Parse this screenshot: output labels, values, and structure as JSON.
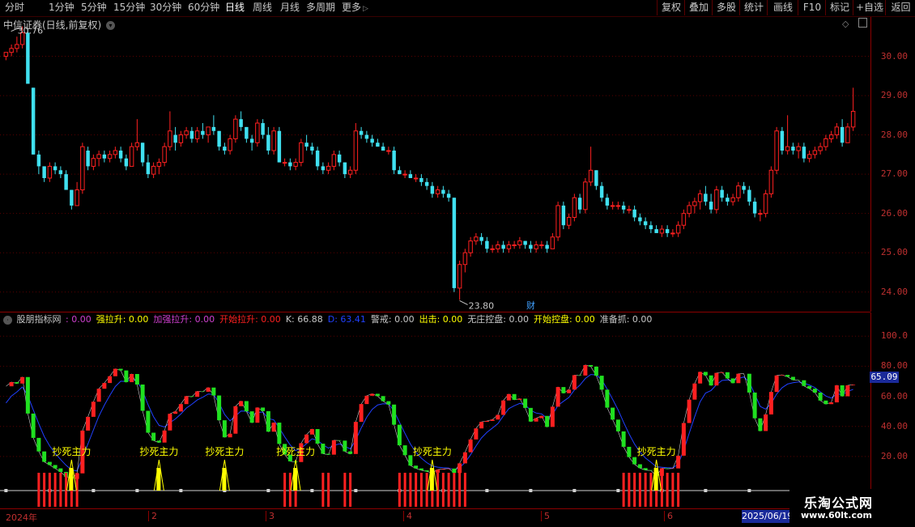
{
  "toolbar": {
    "periods": [
      "分时",
      "1分钟",
      "5分钟",
      "15分钟",
      "30分钟",
      "60分钟",
      "日线",
      "周线",
      "月线",
      "多周期",
      "更多"
    ],
    "active_period": "日线",
    "buttons": [
      "复权",
      "叠加",
      "多股",
      "统计",
      "画线",
      "F10",
      "标记",
      "+自选",
      "返回"
    ]
  },
  "main_chart": {
    "title": "中信证券(日线,前复权)",
    "high_label": "30.76",
    "low_label": "23.80",
    "marker_label": "财",
    "y_ticks": [
      "30.00",
      "29.00",
      "28.00",
      "27.00",
      "26.00",
      "25.00",
      "24.00"
    ],
    "y_min": 23.5,
    "y_max": 31.0
  },
  "indicator": {
    "name": "股朋指标网",
    "values": [
      {
        "label": "",
        "value": "0.00",
        "color": "#d040d0"
      },
      {
        "label": "强拉升",
        "value": "0.00",
        "color": "#ffff00"
      },
      {
        "label": "加强拉升",
        "value": "0.00",
        "color": "#d040d0"
      },
      {
        "label": "开始拉升",
        "value": "0.00",
        "color": "#ff2020"
      },
      {
        "label": "K",
        "value": "66.88",
        "color": "#c8c8c8"
      },
      {
        "label": "D",
        "value": "63.41",
        "color": "#2040ff"
      },
      {
        "label": "警戒",
        "value": "0.00",
        "color": "#c8c8c8"
      },
      {
        "label": "出击",
        "value": "0.00",
        "color": "#ffff00"
      },
      {
        "label": "无庄控盘",
        "value": "0.00",
        "color": "#c8c8c8"
      },
      {
        "label": "开始控盘",
        "value": "0.00",
        "color": "#ffff00"
      },
      {
        "label": "准备抓",
        "value": "0.00",
        "color": "#c8c8c8"
      }
    ],
    "y_ticks": [
      "100.0",
      "80.00",
      "60.00",
      "40.00",
      "20.00"
    ],
    "current_value": "65.09",
    "signal_label": "抄死主力"
  },
  "date_axis": {
    "labels": [
      "2024年",
      "2",
      "3",
      "4",
      "5",
      "6"
    ],
    "current_date": "2025/06/19"
  },
  "watermark": {
    "name": "乐淘公式网",
    "url": "www.60lt.com"
  },
  "colors": {
    "up": "#ff2020",
    "down": "#40e0f0",
    "k_up": "#ff2020",
    "k_down": "#20e020",
    "signal": "#ffff00",
    "grid": "#5a0000"
  },
  "chart_data": {
    "type": "candlestick",
    "ohlc": [
      [
        30.0,
        30.1,
        29.9,
        30.1
      ],
      [
        30.1,
        30.3,
        30.0,
        30.2
      ],
      [
        30.2,
        30.5,
        30.1,
        30.3
      ],
      [
        30.3,
        30.76,
        30.2,
        30.6
      ],
      [
        30.6,
        30.7,
        29.3,
        29.3
      ],
      [
        29.2,
        29.2,
        27.5,
        27.5
      ],
      [
        27.5,
        27.6,
        27.0,
        27.2
      ],
      [
        27.2,
        27.2,
        26.8,
        26.9
      ],
      [
        26.9,
        27.3,
        26.8,
        27.2
      ],
      [
        27.2,
        27.3,
        27.0,
        27.1
      ],
      [
        27.1,
        27.2,
        26.9,
        27.0
      ],
      [
        27.0,
        27.1,
        26.6,
        26.6
      ],
      [
        26.6,
        26.6,
        26.1,
        26.2
      ],
      [
        26.2,
        26.8,
        26.2,
        26.6
      ],
      [
        26.6,
        27.8,
        26.5,
        27.7
      ],
      [
        27.6,
        27.7,
        27.1,
        27.2
      ],
      [
        27.2,
        27.5,
        27.1,
        27.4
      ],
      [
        27.4,
        27.6,
        27.2,
        27.5
      ],
      [
        27.5,
        27.6,
        27.3,
        27.4
      ],
      [
        27.4,
        27.6,
        27.3,
        27.5
      ],
      [
        27.5,
        27.7,
        27.4,
        27.6
      ],
      [
        27.6,
        27.7,
        27.3,
        27.4
      ],
      [
        27.4,
        27.5,
        27.1,
        27.2
      ],
      [
        27.2,
        27.8,
        27.2,
        27.7
      ],
      [
        27.7,
        28.4,
        27.6,
        27.8
      ],
      [
        27.8,
        27.8,
        27.2,
        27.3
      ],
      [
        27.3,
        27.5,
        26.9,
        27.0
      ],
      [
        27.0,
        27.3,
        26.9,
        27.2
      ],
      [
        27.2,
        27.4,
        27.0,
        27.3
      ],
      [
        27.3,
        27.8,
        27.2,
        27.7
      ],
      [
        27.7,
        28.6,
        27.6,
        28.1
      ],
      [
        28.0,
        28.2,
        27.6,
        27.8
      ],
      [
        27.8,
        28.1,
        27.7,
        28.0
      ],
      [
        28.0,
        28.2,
        27.9,
        28.1
      ],
      [
        28.1,
        28.2,
        27.8,
        27.9
      ],
      [
        27.9,
        28.2,
        27.8,
        28.1
      ],
      [
        28.1,
        28.3,
        27.9,
        28.0
      ],
      [
        28.0,
        28.2,
        27.8,
        28.2
      ],
      [
        28.2,
        28.5,
        28.0,
        28.1
      ],
      [
        28.1,
        28.1,
        27.6,
        27.7
      ],
      [
        27.7,
        27.8,
        27.5,
        27.6
      ],
      [
        27.6,
        28.0,
        27.5,
        27.9
      ],
      [
        27.9,
        28.5,
        27.8,
        28.4
      ],
      [
        28.4,
        28.6,
        28.1,
        28.2
      ],
      [
        28.2,
        28.2,
        27.8,
        27.9
      ],
      [
        27.9,
        28.0,
        27.6,
        27.8
      ],
      [
        27.8,
        28.4,
        27.7,
        28.3
      ],
      [
        28.3,
        28.4,
        27.9,
        28.0
      ],
      [
        28.0,
        28.2,
        27.5,
        27.6
      ],
      [
        27.6,
        28.2,
        27.5,
        28.1
      ],
      [
        28.1,
        28.2,
        27.3,
        27.3
      ],
      [
        27.3,
        27.4,
        27.2,
        27.3
      ],
      [
        27.3,
        27.4,
        27.1,
        27.2
      ],
      [
        27.2,
        27.4,
        27.1,
        27.3
      ],
      [
        27.3,
        27.9,
        27.2,
        27.8
      ],
      [
        27.8,
        28.0,
        27.6,
        27.7
      ],
      [
        27.7,
        27.8,
        27.5,
        27.6
      ],
      [
        27.6,
        27.7,
        27.1,
        27.2
      ],
      [
        27.2,
        27.3,
        27.0,
        27.1
      ],
      [
        27.1,
        27.3,
        27.0,
        27.2
      ],
      [
        27.2,
        27.6,
        27.1,
        27.5
      ],
      [
        27.5,
        27.6,
        27.2,
        27.3
      ],
      [
        27.3,
        27.3,
        26.9,
        27.0
      ],
      [
        27.0,
        27.2,
        26.9,
        27.1
      ],
      [
        27.1,
        28.3,
        27.0,
        28.1
      ],
      [
        28.1,
        28.2,
        27.9,
        28.0
      ],
      [
        28.0,
        28.1,
        27.8,
        27.9
      ],
      [
        27.9,
        28.0,
        27.7,
        27.8
      ],
      [
        27.8,
        27.9,
        27.7,
        27.7
      ],
      [
        27.7,
        27.8,
        27.6,
        27.6
      ],
      [
        27.6,
        27.7,
        27.5,
        27.6
      ],
      [
        27.6,
        27.7,
        27.0,
        27.1
      ],
      [
        27.1,
        27.2,
        27.0,
        27.0
      ],
      [
        27.0,
        27.1,
        26.9,
        27.0
      ],
      [
        27.0,
        27.1,
        26.9,
        26.9
      ],
      [
        26.9,
        27.0,
        26.8,
        26.9
      ],
      [
        26.9,
        27.0,
        26.7,
        26.8
      ],
      [
        26.8,
        26.9,
        26.6,
        26.7
      ],
      [
        26.7,
        26.8,
        26.4,
        26.5
      ],
      [
        26.5,
        26.7,
        26.4,
        26.6
      ],
      [
        26.6,
        26.7,
        26.4,
        26.5
      ],
      [
        26.5,
        26.6,
        26.3,
        26.4
      ],
      [
        26.4,
        26.4,
        24.0,
        24.1
      ],
      [
        24.1,
        24.8,
        23.8,
        24.7
      ],
      [
        24.7,
        25.1,
        24.5,
        25.0
      ],
      [
        25.0,
        25.4,
        24.9,
        25.3
      ],
      [
        25.3,
        25.5,
        25.2,
        25.4
      ],
      [
        25.4,
        25.5,
        25.2,
        25.3
      ],
      [
        25.3,
        25.4,
        25.0,
        25.1
      ],
      [
        25.1,
        25.2,
        25.0,
        25.1
      ],
      [
        25.1,
        25.3,
        25.0,
        25.2
      ],
      [
        25.2,
        25.3,
        25.0,
        25.1
      ],
      [
        25.1,
        25.3,
        25.0,
        25.2
      ],
      [
        25.2,
        25.3,
        25.1,
        25.2
      ],
      [
        25.2,
        25.4,
        25.1,
        25.3
      ],
      [
        25.3,
        25.3,
        25.1,
        25.2
      ],
      [
        25.2,
        25.3,
        25.0,
        25.1
      ],
      [
        25.1,
        25.3,
        25.0,
        25.2
      ],
      [
        25.2,
        25.3,
        25.1,
        25.2
      ],
      [
        25.2,
        25.3,
        25.0,
        25.1
      ],
      [
        25.1,
        25.5,
        25.1,
        25.4
      ],
      [
        25.4,
        26.3,
        25.3,
        26.2
      ],
      [
        26.2,
        26.3,
        25.6,
        25.7
      ],
      [
        25.7,
        26.0,
        25.6,
        25.9
      ],
      [
        25.9,
        26.5,
        25.8,
        26.4
      ],
      [
        26.4,
        26.5,
        26.0,
        26.1
      ],
      [
        26.1,
        26.9,
        26.0,
        26.8
      ],
      [
        26.8,
        27.7,
        26.7,
        27.1
      ],
      [
        27.1,
        27.1,
        26.6,
        26.7
      ],
      [
        26.7,
        26.8,
        26.3,
        26.4
      ],
      [
        26.4,
        26.5,
        26.1,
        26.2
      ],
      [
        26.2,
        26.3,
        26.1,
        26.2
      ],
      [
        26.2,
        26.3,
        26.1,
        26.2
      ],
      [
        26.2,
        26.3,
        26.0,
        26.1
      ],
      [
        26.1,
        26.2,
        26.0,
        26.1
      ],
      [
        26.1,
        26.2,
        25.8,
        25.9
      ],
      [
        25.9,
        26.0,
        25.7,
        25.8
      ],
      [
        25.8,
        25.9,
        25.6,
        25.7
      ],
      [
        25.7,
        25.8,
        25.5,
        25.6
      ],
      [
        25.6,
        25.7,
        25.5,
        25.5
      ],
      [
        25.5,
        25.7,
        25.4,
        25.6
      ],
      [
        25.6,
        25.7,
        25.4,
        25.5
      ],
      [
        25.5,
        25.6,
        25.4,
        25.5
      ],
      [
        25.5,
        25.8,
        25.4,
        25.7
      ],
      [
        25.7,
        26.1,
        25.6,
        26.0
      ],
      [
        26.0,
        26.3,
        25.9,
        26.2
      ],
      [
        26.2,
        26.4,
        26.0,
        26.3
      ],
      [
        26.3,
        26.6,
        26.1,
        26.5
      ],
      [
        26.5,
        26.7,
        26.2,
        26.3
      ],
      [
        26.3,
        26.5,
        26.0,
        26.1
      ],
      [
        26.1,
        26.7,
        26.0,
        26.6
      ],
      [
        26.6,
        26.7,
        26.3,
        26.4
      ],
      [
        26.4,
        26.5,
        26.2,
        26.3
      ],
      [
        26.3,
        26.5,
        26.2,
        26.4
      ],
      [
        26.4,
        26.8,
        26.3,
        26.7
      ],
      [
        26.7,
        26.8,
        26.5,
        26.6
      ],
      [
        26.6,
        26.7,
        26.2,
        26.3
      ],
      [
        26.3,
        26.4,
        25.9,
        26.0
      ],
      [
        26.0,
        26.1,
        25.8,
        26.0
      ],
      [
        26.0,
        26.6,
        25.9,
        26.5
      ],
      [
        26.5,
        27.2,
        26.4,
        27.1
      ],
      [
        27.1,
        28.2,
        27.0,
        28.1
      ],
      [
        28.1,
        28.2,
        27.5,
        27.6
      ],
      [
        27.6,
        28.5,
        27.5,
        27.7
      ],
      [
        27.7,
        27.8,
        27.5,
        27.6
      ],
      [
        27.6,
        27.8,
        27.4,
        27.7
      ],
      [
        27.7,
        27.8,
        27.3,
        27.4
      ],
      [
        27.4,
        27.6,
        27.3,
        27.5
      ],
      [
        27.5,
        27.7,
        27.4,
        27.6
      ],
      [
        27.6,
        27.8,
        27.5,
        27.7
      ],
      [
        27.7,
        28.0,
        27.6,
        27.9
      ],
      [
        27.9,
        28.1,
        27.8,
        28.0
      ],
      [
        28.0,
        28.3,
        27.9,
        28.2
      ],
      [
        28.2,
        28.4,
        27.7,
        27.8
      ],
      [
        27.8,
        28.3,
        27.8,
        28.2
      ],
      [
        28.2,
        29.2,
        28.1,
        28.6
      ]
    ]
  }
}
